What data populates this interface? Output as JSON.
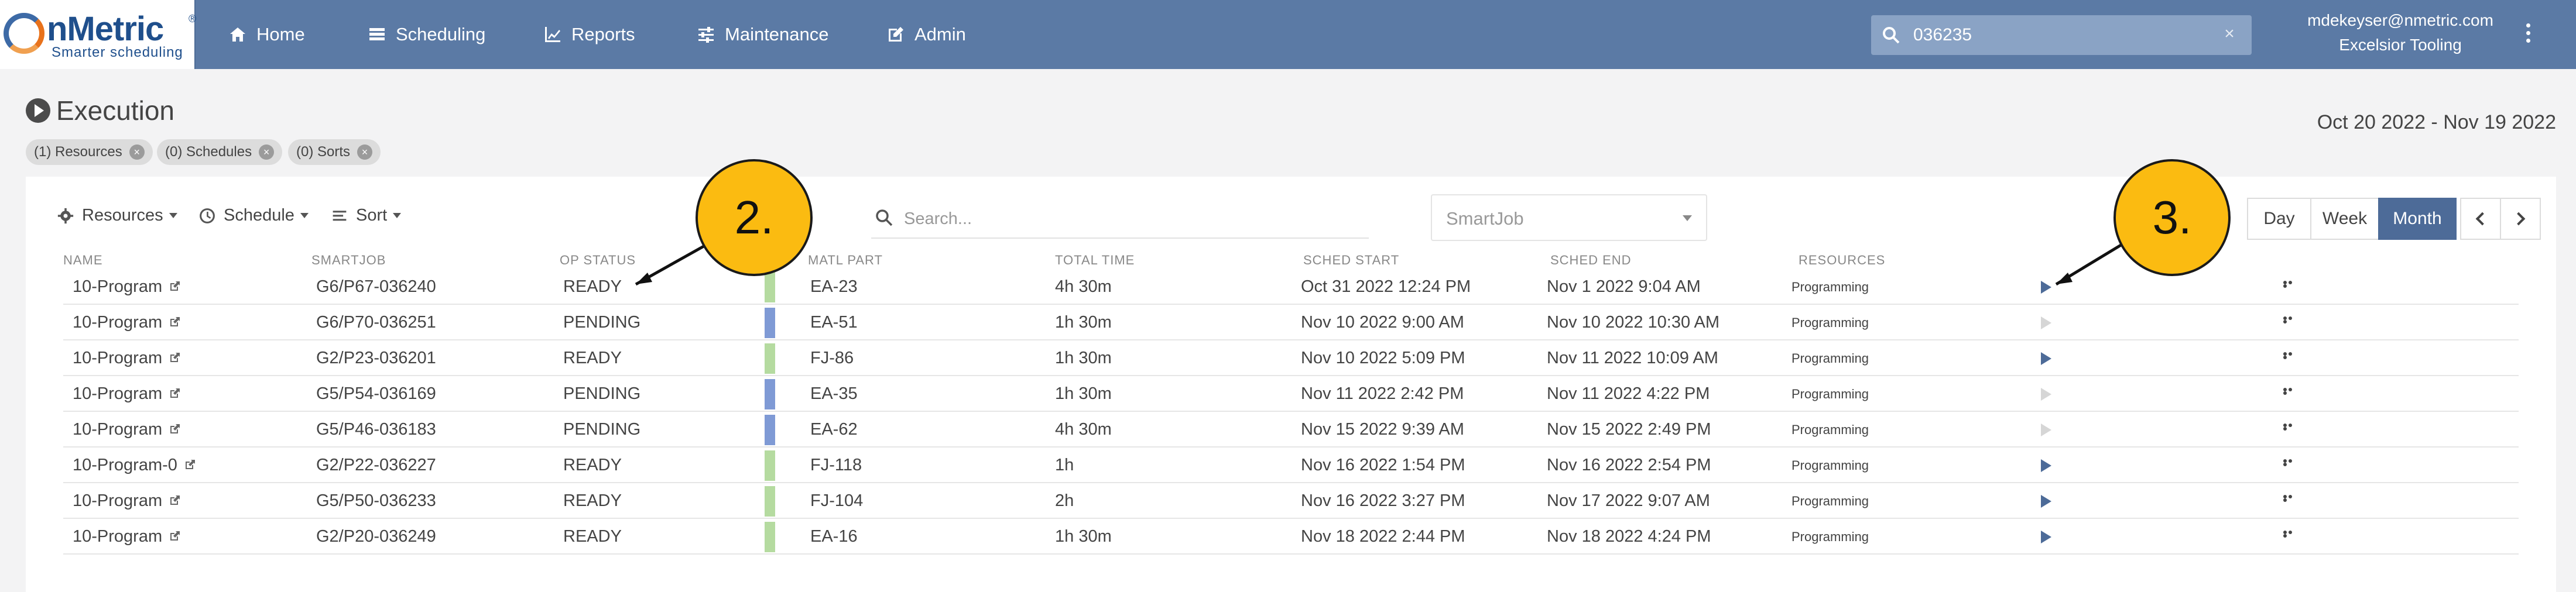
{
  "brand": {
    "name": "nMetric",
    "registered": "®",
    "tagline": "Smarter scheduling"
  },
  "nav": {
    "items": [
      {
        "label": "Home",
        "icon": "home-icon"
      },
      {
        "label": "Scheduling",
        "icon": "scheduling-icon"
      },
      {
        "label": "Reports",
        "icon": "chart-line-icon"
      },
      {
        "label": "Maintenance",
        "icon": "sliders-icon"
      },
      {
        "label": "Admin",
        "icon": "edit-icon"
      }
    ],
    "search_value": "036235",
    "clear_glyph": "×",
    "user_email": "mdekeyser@nmetric.com",
    "user_org": "Excelsior Tooling"
  },
  "page": {
    "title": "Execution",
    "date_range": "Oct 20 2022 - Nov 19 2022",
    "chips": [
      {
        "label": "(1) Resources"
      },
      {
        "label": "(0) Schedules"
      },
      {
        "label": "(0) Sorts"
      }
    ]
  },
  "toolbar": {
    "resources_label": "Resources",
    "schedule_label": "Schedule",
    "sort_label": "Sort",
    "search_placeholder": "Search...",
    "smartjob_placeholder": "SmartJob",
    "day_label": "Day",
    "week_label": "Week",
    "month_label": "Month",
    "active_view": "Month"
  },
  "table": {
    "headers": {
      "name": "NAME",
      "smartjob": "SMARTJOB",
      "op_status": "OP STATUS",
      "matl_part": "MATL PART",
      "total_time": "TOTAL TIME",
      "sched_start": "SCHED START",
      "sched_end": "SCHED END",
      "resources": "RESOURCES"
    },
    "rows": [
      {
        "name": "10-Program",
        "smartjob": "G6/P67-036240",
        "status": "READY",
        "status_color": "#b5dba0",
        "part": "EA-23",
        "total": "4h 30m",
        "start": "Oct 31 2022 12:24 PM",
        "end": "Nov 1 2022 9:04 AM",
        "resource": "Programming",
        "play_enabled": true
      },
      {
        "name": "10-Program",
        "smartjob": "G6/P70-036251",
        "status": "PENDING",
        "status_color": "#7f9ad5",
        "part": "EA-51",
        "total": "1h 30m",
        "start": "Nov 10 2022 9:00 AM",
        "end": "Nov 10 2022 10:30 AM",
        "resource": "Programming",
        "play_enabled": false
      },
      {
        "name": "10-Program",
        "smartjob": "G2/P23-036201",
        "status": "READY",
        "status_color": "#b5dba0",
        "part": "FJ-86",
        "total": "1h 30m",
        "start": "Nov 10 2022 5:09 PM",
        "end": "Nov 11 2022 10:09 AM",
        "resource": "Programming",
        "play_enabled": true
      },
      {
        "name": "10-Program",
        "smartjob": "G5/P54-036169",
        "status": "PENDING",
        "status_color": "#7f9ad5",
        "part": "EA-35",
        "total": "1h 30m",
        "start": "Nov 11 2022 2:42 PM",
        "end": "Nov 11 2022 4:22 PM",
        "resource": "Programming",
        "play_enabled": false
      },
      {
        "name": "10-Program",
        "smartjob": "G5/P46-036183",
        "status": "PENDING",
        "status_color": "#7f9ad5",
        "part": "EA-62",
        "total": "4h 30m",
        "start": "Nov 15 2022 9:39 AM",
        "end": "Nov 15 2022 2:49 PM",
        "resource": "Programming",
        "play_enabled": false
      },
      {
        "name": "10-Program-0",
        "smartjob": "G2/P22-036227",
        "status": "READY",
        "status_color": "#b5dba0",
        "part": "FJ-118",
        "total": "1h",
        "start": "Nov 16 2022 1:54 PM",
        "end": "Nov 16 2022 2:54 PM",
        "resource": "Programming",
        "play_enabled": true
      },
      {
        "name": "10-Program",
        "smartjob": "G5/P50-036233",
        "status": "READY",
        "status_color": "#b5dba0",
        "part": "FJ-104",
        "total": "2h",
        "start": "Nov 16 2022 3:27 PM",
        "end": "Nov 17 2022 9:07 AM",
        "resource": "Programming",
        "play_enabled": true
      },
      {
        "name": "10-Program",
        "smartjob": "G2/P20-036249",
        "status": "READY",
        "status_color": "#b5dba0",
        "part": "EA-16",
        "total": "1h 30m",
        "start": "Nov 18 2022 2:44 PM",
        "end": "Nov 18 2022 4:24 PM",
        "resource": "Programming",
        "play_enabled": true
      }
    ]
  },
  "callouts": [
    {
      "label": "2."
    },
    {
      "label": "3."
    }
  ],
  "colors": {
    "navbar": "#5b7aa5",
    "accent": "#4d6b98",
    "ready": "#b5dba0",
    "pending": "#7f9ad5",
    "callout": "#fbbb11"
  }
}
